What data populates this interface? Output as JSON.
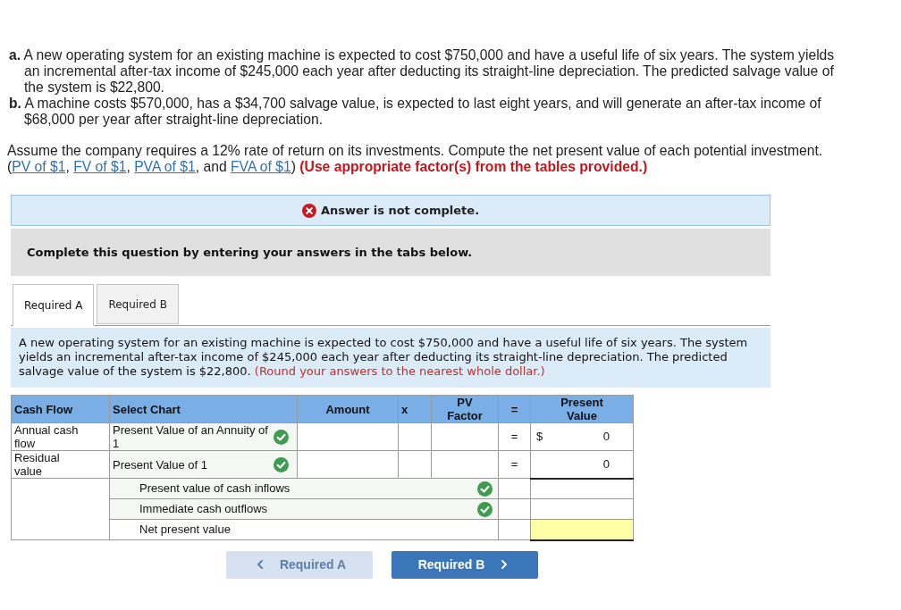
{
  "problem": {
    "items": [
      {
        "label": "a.",
        "text": "A new operating system for an existing machine is expected to cost $750,000 and have a useful life of six years. The system yields an incremental after-tax income of $245,000 each year after deducting its straight-line depreciation. The predicted salvage value of the system is $22,800."
      },
      {
        "label": "b.",
        "text": "A machine costs $570,000, has a $34,700 salvage value, is expected to last eight years, and will generate an after-tax income of $68,000 per year after straight-line depreciation."
      }
    ]
  },
  "instructions": {
    "question": "Assume the company requires a 12% rate of return on its investments. Compute the net present value of each potential investment.",
    "references": [
      {
        "kind": "text",
        "text": "("
      },
      {
        "kind": "link",
        "text": "PV of $1"
      },
      {
        "kind": "text",
        "text": ", "
      },
      {
        "kind": "link",
        "text": "FV of $1"
      },
      {
        "kind": "text",
        "text": ", "
      },
      {
        "kind": "link",
        "text": "PVA of $1"
      },
      {
        "kind": "text",
        "text": ", and "
      },
      {
        "kind": "link",
        "text": "FVA of $1"
      },
      {
        "kind": "text",
        "text": ") "
      },
      {
        "kind": "note",
        "text": "(Use appropriate factor(s) from the tables provided.)"
      }
    ]
  },
  "status": {
    "kind": "incomplete",
    "text": "Answer is not complete."
  },
  "prompt": "Complete this question by entering your answers in the tabs below.",
  "tabs": [
    {
      "label": "Required A",
      "selected": true
    },
    {
      "label": "Required B",
      "selected": false
    }
  ],
  "panel": {
    "text": "A new operating system for an existing machine is expected to cost $750,000 and have a useful life of six years. The system yields an incremental after-tax income of $245,000 each year after deducting its straight-line depreciation. The predicted salvage value of the system is $22,800.",
    "note": "(Round your answers to the nearest whole dollar.)"
  },
  "table": {
    "columns": [
      "Cash Flow",
      "Select Chart",
      "Amount",
      "x",
      "PV Factor",
      "=",
      "Present Value"
    ],
    "rows": [
      {
        "cash_flow": "Annual cash flow",
        "chart": "Present Value of an Annuity of 1",
        "chart_correct": true,
        "operator": "=",
        "currency": "$",
        "present_value": "0"
      },
      {
        "cash_flow": "Residual value",
        "chart": "Present Value of 1",
        "chart_correct": true,
        "operator": "=",
        "present_value": "0"
      }
    ],
    "totals": [
      {
        "kind": "graded",
        "label": "Present value of cash inflows",
        "correct": true,
        "highlighted": false
      },
      {
        "kind": "graded",
        "label": "Immediate cash outflows",
        "correct": true,
        "highlighted": false
      },
      {
        "kind": "plain",
        "label": "Net present value",
        "highlighted": true
      }
    ]
  },
  "navigation": [
    {
      "kind": "previous",
      "label": "Required A",
      "disabled": true
    },
    {
      "kind": "next",
      "label": "Required B",
      "disabled": false
    }
  ]
}
